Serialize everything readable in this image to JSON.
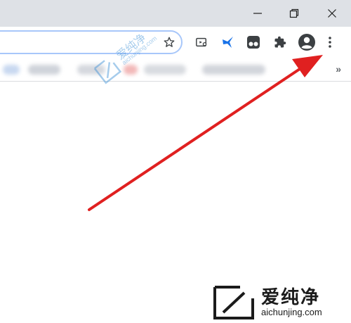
{
  "window": {
    "controls": [
      {
        "name": "minimize-icon",
        "label": "Minimize"
      },
      {
        "name": "restore-icon",
        "label": "Restore"
      },
      {
        "name": "close-icon",
        "label": "Close"
      }
    ]
  },
  "toolbar": {
    "bookmark_star_icon": "star-outline",
    "icons": [
      "media-cast-icon",
      "bird-extension-icon",
      "tampermonkey-extension-icon",
      "puzzle-extensions-icon",
      "profile-avatar-icon",
      "more-menu-icon"
    ]
  },
  "bookmarks_bar": {
    "overflow_label": "»"
  },
  "watermark": {
    "zh": "爱纯净",
    "en": "aichunjing.com"
  },
  "annotation": {
    "arrow_color": "#e02020",
    "arrow_target": "more-menu-icon"
  },
  "colors": {
    "titlebar": "#dee1e6",
    "omnibox_border": "#a8c7fa",
    "icon": "#3c4043",
    "extension_blue": "#1a73e8"
  }
}
